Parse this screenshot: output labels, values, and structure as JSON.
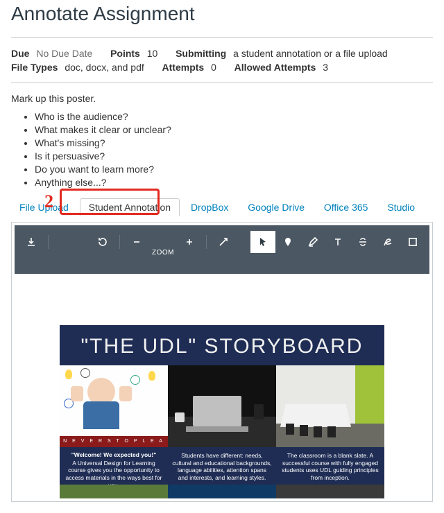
{
  "page": {
    "title": "Annotate Assignment"
  },
  "meta": {
    "due_label": "Due",
    "due_value": "No Due Date",
    "points_label": "Points",
    "points_value": "10",
    "submitting_label": "Submitting",
    "submitting_value": "a student annotation or a file upload",
    "filetypes_label": "File Types",
    "filetypes_value": "doc, docx, and pdf",
    "attempts_label": "Attempts",
    "attempts_value": "0",
    "allowed_label": "Allowed Attempts",
    "allowed_value": "3"
  },
  "instructions": {
    "lead": "Mark up this poster.",
    "questions": [
      "Who is the audience?",
      "What makes it clear or unclear?",
      "What's missing?",
      "Is it persuasive?",
      "Do you want to learn more?",
      "Anything else...?"
    ]
  },
  "tabs": {
    "items": [
      "File Upload",
      "Student Annotation",
      "DropBox",
      "Google Drive",
      "Office 365",
      "Studio"
    ],
    "active_index": 1,
    "callout_number": "2"
  },
  "toolbar": {
    "zoom_label": "ZOOM"
  },
  "poster": {
    "title": "\"THE UDL\" STORYBOARD",
    "banner": "N E V E R   S T O P   L E A R N",
    "captions": [
      {
        "title": "\"Welcome! We expected you!\"",
        "body": "A Universal Design for Learning course gives you the opportunity to access materials in the ways best for you."
      },
      {
        "title": "",
        "body": "Students have different: needs, cultural and educational backgrounds, language abilities, attention spans and interests, and learning styles."
      },
      {
        "title": "",
        "body": "The classroom is a blank slate. A successful course with fully engaged students uses UDL guiding principles from inception."
      }
    ]
  }
}
